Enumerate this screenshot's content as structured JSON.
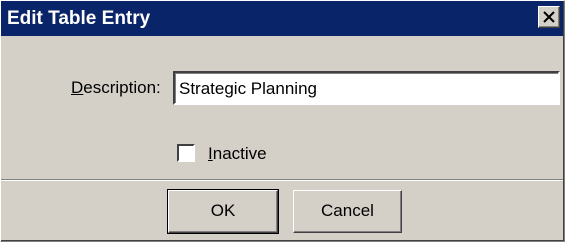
{
  "window": {
    "title": "Edit Table Entry",
    "close_icon": "close-icon"
  },
  "form": {
    "description_label_mnemonic": "D",
    "description_label_rest": "escription:",
    "description_value": "Strategic Planning",
    "inactive_checked": false,
    "inactive_label_mnemonic": "I",
    "inactive_label_rest": "nactive"
  },
  "buttons": {
    "ok_label": "OK",
    "cancel_label": "Cancel"
  },
  "colors": {
    "titlebar": "#0a246a",
    "face": "#d4d0c8"
  }
}
